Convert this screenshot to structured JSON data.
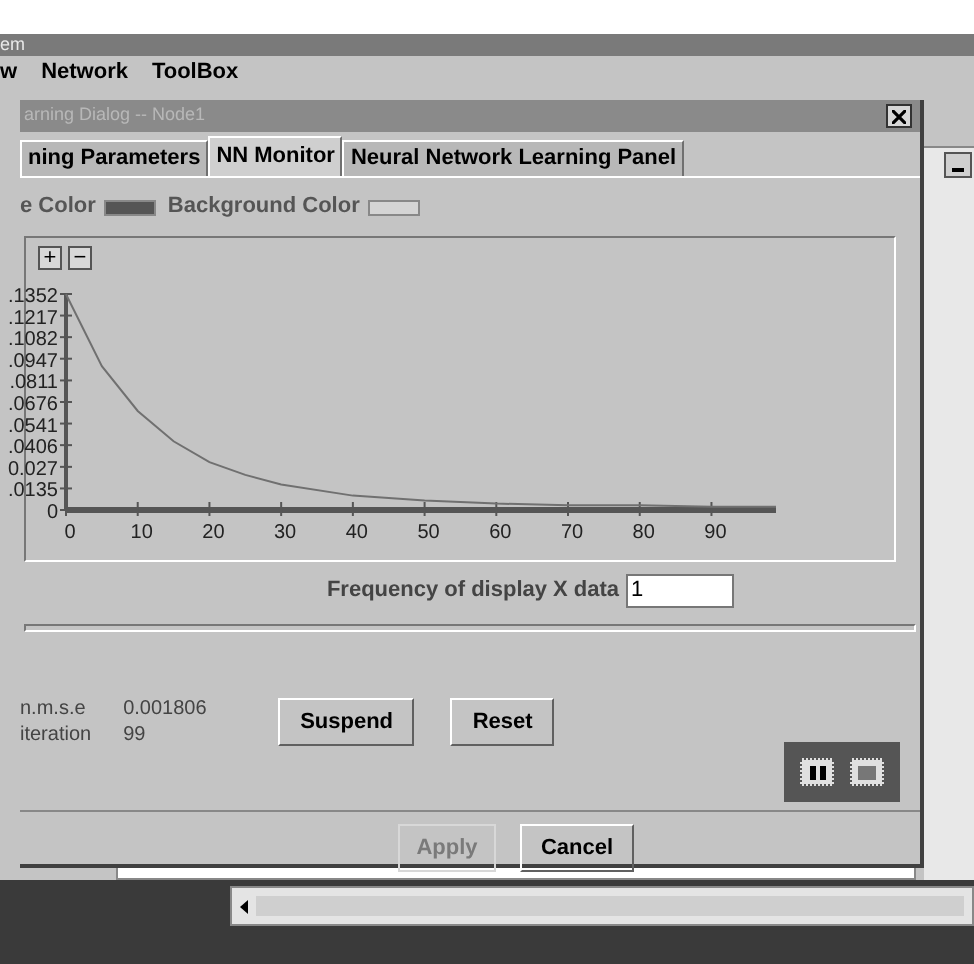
{
  "app_window": {
    "title": "em",
    "menu": [
      "w",
      "Network",
      "ToolBox"
    ]
  },
  "dialog": {
    "title": "arning Dialog -- Node1",
    "tabs": [
      {
        "label": "ning Parameters",
        "selected": false
      },
      {
        "label": "NN Monitor",
        "selected": true
      },
      {
        "label": "Neural Network Learning Panel",
        "selected": false
      }
    ],
    "colors": [
      {
        "label": "e Color",
        "color": "#555555"
      },
      {
        "label": "Background Color",
        "color": "#d4d4d4"
      }
    ],
    "zoom_buttons": [
      "+",
      "−"
    ],
    "chart_data": {
      "type": "line",
      "x": [
        0,
        5,
        10,
        15,
        20,
        25,
        30,
        40,
        50,
        60,
        70,
        80,
        90,
        99
      ],
      "series": [
        {
          "color": "#707070",
          "values": [
            0.135,
            0.09,
            0.062,
            0.043,
            0.03,
            0.022,
            0.016,
            0.009,
            0.006,
            0.004,
            0.003,
            0.003,
            0.002,
            0.002
          ]
        }
      ],
      "xlim": [
        0,
        99
      ],
      "ylim": [
        0,
        0.1352
      ],
      "xticks": [
        0,
        10,
        20,
        30,
        40,
        50,
        60,
        70,
        80,
        90
      ],
      "yticks": [
        {
          "value": 0,
          "label": "0"
        },
        {
          "value": 0.0135,
          "label": ".0135"
        },
        {
          "value": 0.027,
          "label": "0.027"
        },
        {
          "value": 0.0406,
          "label": ".0406"
        },
        {
          "value": 0.0541,
          "label": ".0541"
        },
        {
          "value": 0.0676,
          "label": ".0676"
        },
        {
          "value": 0.0811,
          "label": ".0811"
        },
        {
          "value": 0.0947,
          "label": ".0947"
        },
        {
          "value": 0.1082,
          "label": ".1082"
        },
        {
          "value": 0.1217,
          "label": ".1217"
        },
        {
          "value": 0.1352,
          "label": ".1352"
        }
      ]
    },
    "frequency": {
      "label": "Frequency of display X data",
      "value": "1"
    },
    "stats": [
      {
        "label": "n.m.s.e",
        "value": "0.001806"
      },
      {
        "label": "iteration",
        "value": "99"
      }
    ],
    "actions": [
      {
        "label": "Suspend",
        "disabled": false
      },
      {
        "label": "Reset",
        "disabled": false
      }
    ],
    "footer": [
      {
        "label": "Apply",
        "disabled": true
      },
      {
        "label": "Cancel",
        "disabled": false
      }
    ]
  }
}
